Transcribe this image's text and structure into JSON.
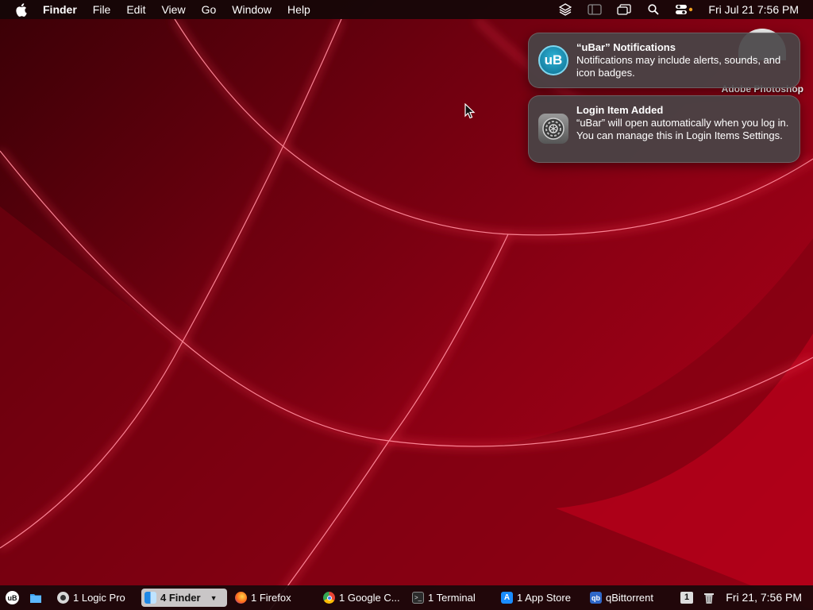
{
  "menubar": {
    "apple_icon": "apple-logo-icon",
    "app_name": "Finder",
    "menus": [
      "File",
      "Edit",
      "View",
      "Go",
      "Window",
      "Help"
    ],
    "status_icons": [
      "layers-icon",
      "sidebar-icon",
      "screen-mirroring-icon",
      "search-icon",
      "control-center-icon"
    ],
    "clock": "Fri Jul 21  7:56 PM"
  },
  "desktop": {
    "icon_label": "Adobe Photoshop"
  },
  "notifications": [
    {
      "app_icon": "ubar-icon",
      "icon_text": "uB",
      "title": "“uBar” Notifications",
      "body": "Notifications may include alerts, sounds, and icon badges."
    },
    {
      "app_icon": "system-settings-icon",
      "title": "Login Item Added",
      "body": "“uBar” will open automatically when you log in. You can manage this in Login Items Settings."
    }
  ],
  "taskbar": {
    "ubar_button": "uB",
    "items": [
      {
        "label": "1 Logic Pro",
        "icon": "logic-pro-icon",
        "active": false
      },
      {
        "label": "4 Finder",
        "icon": "finder-icon",
        "active": true
      },
      {
        "label": "1 Firefox",
        "icon": "firefox-icon",
        "active": false
      },
      {
        "label": "1 Google C...",
        "icon": "chrome-icon",
        "active": false
      },
      {
        "label": "1 Terminal",
        "icon": "terminal-icon",
        "active": false
      },
      {
        "label": "1 App Store",
        "icon": "app-store-icon",
        "active": false
      },
      {
        "label": "qBittorrent",
        "icon": "qbittorrent-icon",
        "active": false
      }
    ],
    "badge": "1",
    "clock": "Fri 21, 7:56 PM"
  },
  "colors": {
    "wallpaper_red": "#e0102e",
    "menubar_bg": "#140608",
    "notification_bg": "#484446",
    "active_task_bg": "#c9c6c7"
  }
}
